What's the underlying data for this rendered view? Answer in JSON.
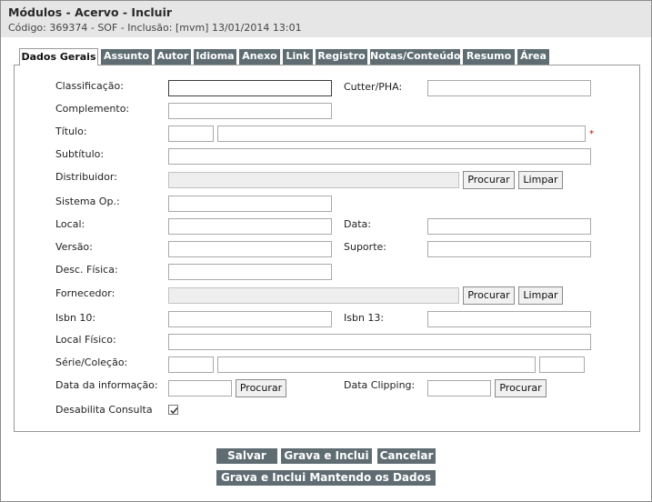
{
  "header": {
    "title": "Módulos - Acervo - Incluir",
    "subtitle": "Código: 369374 - SOF - Inclusão: [mvm] 13/01/2014 13:01"
  },
  "tabs": [
    {
      "label": "Dados Gerais",
      "active": true
    },
    {
      "label": "Assunto"
    },
    {
      "label": "Autor"
    },
    {
      "label": "Idioma"
    },
    {
      "label": "Anexo"
    },
    {
      "label": "Link"
    },
    {
      "label": "Registro"
    },
    {
      "label": "Notas/Conteúdo"
    },
    {
      "label": "Resumo"
    },
    {
      "label": "Área"
    }
  ],
  "form": {
    "classificacao": "Classificação:",
    "cutter": "Cutter/PHA:",
    "complemento": "Complemento:",
    "titulo": "Título:",
    "required_mark": "*",
    "subtitulo": "Subtítulo:",
    "distribuidor": "Distribuidor:",
    "sistema_op": "Sistema Op.:",
    "local": "Local:",
    "data": "Data:",
    "versao": "Versão:",
    "suporte": "Suporte:",
    "desc_fisica": "Desc. Física:",
    "fornecedor": "Fornecedor:",
    "isbn10": "Isbn 10:",
    "isbn13": "Isbn 13:",
    "local_fisico": "Local Físico:",
    "serie_colecao": "Série/Coleção:",
    "data_informacao": "Data da informação:",
    "data_clipping": "Data Clipping:",
    "desabilita_consulta": "Desabilita Consulta",
    "desabilita_checked": true,
    "procurar": "Procurar",
    "limpar": "Limpar"
  },
  "actions": {
    "salvar": "Salvar",
    "grava_inclui": "Grava e Inclui",
    "cancelar": "Cancelar",
    "grava_mantendo": "Grava e Inclui Mantendo os Dados"
  }
}
